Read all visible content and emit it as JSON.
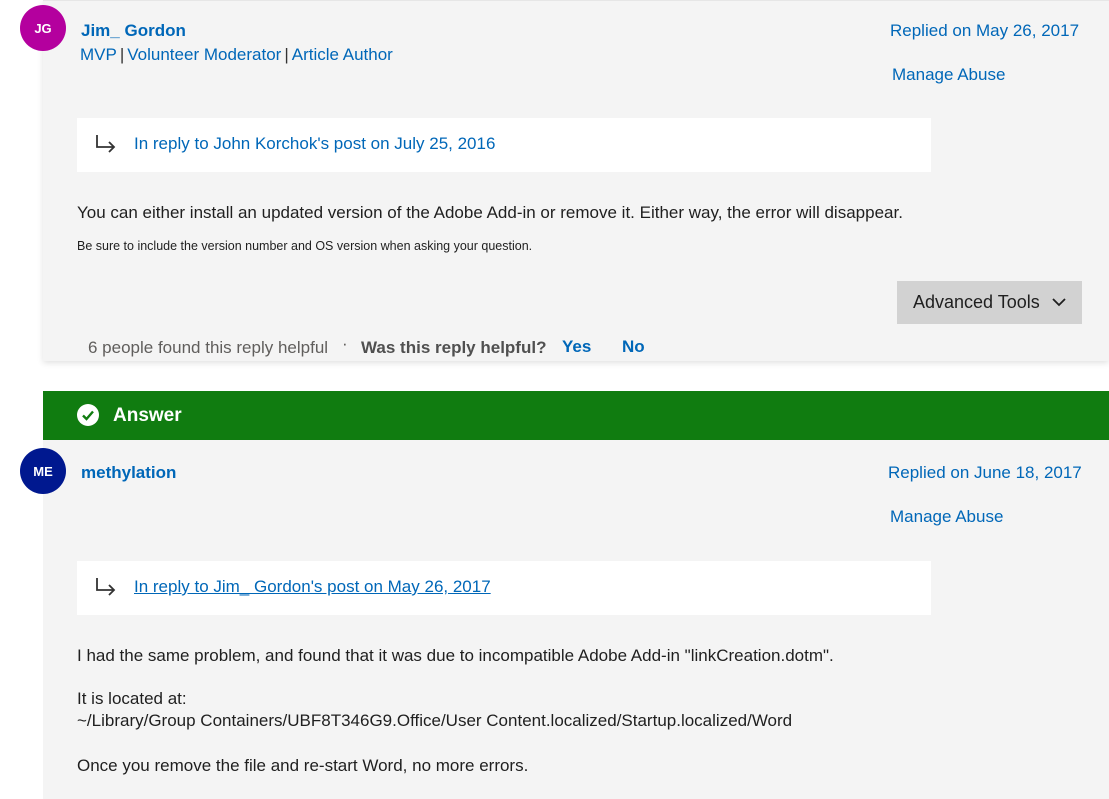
{
  "post1": {
    "avatar_initials": "JG",
    "username": "Jim_ Gordon",
    "roles": [
      "MVP",
      "Volunteer Moderator",
      "Article Author"
    ],
    "replied_on": "Replied on May 26, 2017",
    "manage_abuse": "Manage Abuse",
    "in_reply_to": "In reply to John Korchok's post on July 25, 2016",
    "body": "You can either install an updated version of the Adobe Add-in or remove it. Either way, the error will disappear.",
    "signature": "Be sure to include the version number and OS version when asking your question.",
    "advanced_tools": "Advanced Tools",
    "helpful_count": "6 people found this reply helpful",
    "separator": "·",
    "was_helpful": "Was this reply helpful?",
    "yes": "Yes",
    "no": "No"
  },
  "answer_bar": {
    "label": "Answer",
    "color": "#107c10"
  },
  "post2": {
    "avatar_initials": "ME",
    "username": "methylation",
    "replied_on": "Replied on June 18, 2017",
    "manage_abuse": "Manage Abuse",
    "in_reply_to": "In reply to Jim_ Gordon's post on May 26, 2017",
    "body_line1": "I had the same problem, and found that it was due to incompatible Adobe Add-in \"linkCreation.dotm\".",
    "body_line2": "It is located at:",
    "body_line3": "~/Library/Group Containers/UBF8T346G9.Office/User Content.localized/Startup.localized/Word",
    "body_line4": "Once you remove the file and re-start Word, no more errors."
  },
  "colors": {
    "link": "#0067b8",
    "avatar1": "#b4009e",
    "avatar2": "#00188f",
    "card_bg": "#f4f4f4"
  }
}
